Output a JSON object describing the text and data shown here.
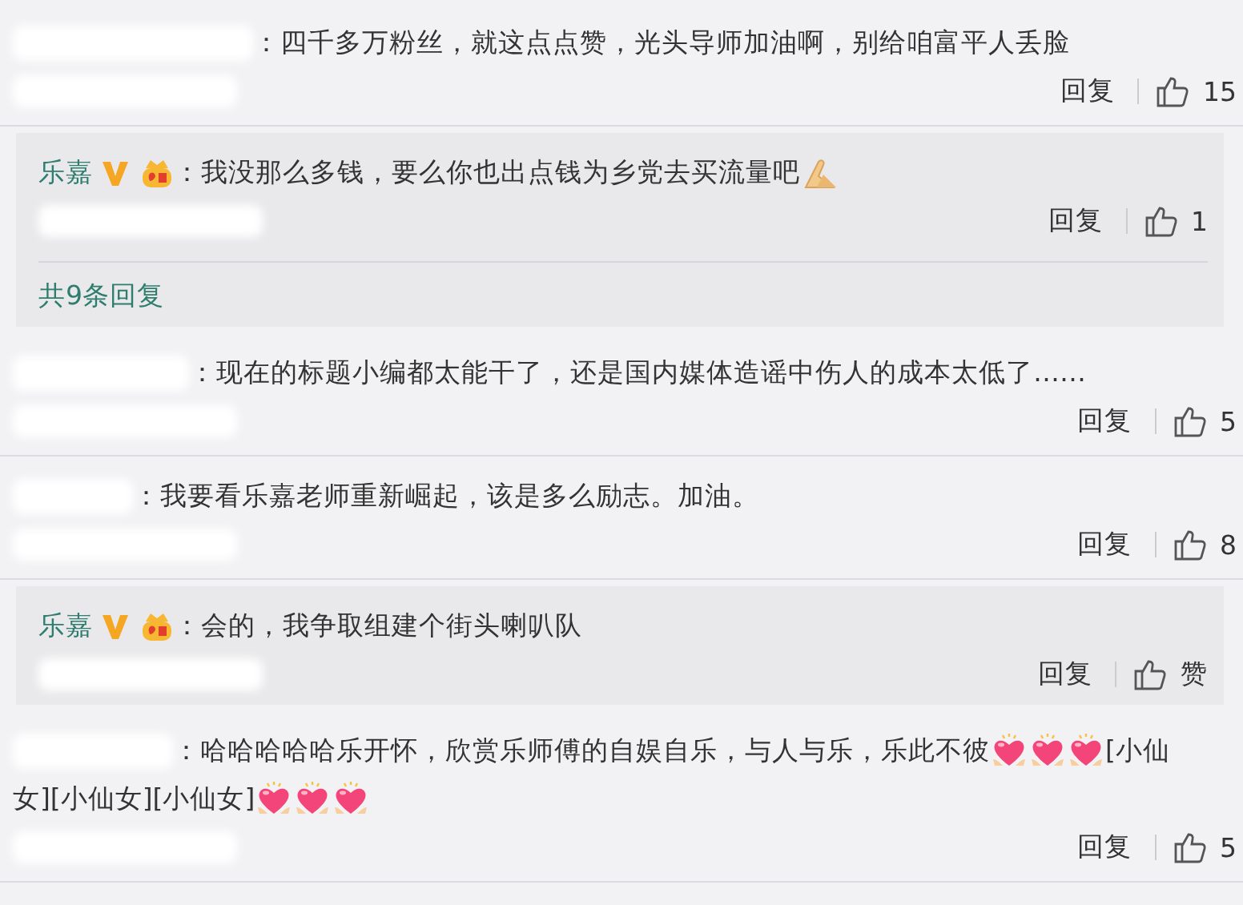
{
  "comments": [
    {
      "kind": "comment",
      "parts": [
        {
          "kind": "text",
          "text": "：四千多万粉丝，就这点点赞，光头导师加油啊，别给咱富平人丢脸"
        }
      ],
      "reply_label": "回复",
      "likes": "15"
    },
    {
      "kind": "reply",
      "user": {
        "name": "乐嘉",
        "verified": true,
        "badge": true
      },
      "parts": [
        {
          "kind": "text",
          "text": "：我没那么多钱，要么你也出点钱为乡党去买流量吧"
        },
        {
          "kind": "palms"
        }
      ],
      "reply_label": "回复",
      "likes": "1",
      "more": "共9条回复"
    },
    {
      "kind": "comment",
      "parts": [
        {
          "kind": "text",
          "text": "：现在的标题小编都太能干了，还是国内媒体造谣中伤人的成本太低了……"
        }
      ],
      "reply_label": "回复",
      "likes": "5"
    },
    {
      "kind": "comment",
      "parts": [
        {
          "kind": "text",
          "text": "：我要看乐嘉老师重新崛起，该是多么励志。加油。"
        }
      ],
      "reply_label": "回复",
      "likes": "8"
    },
    {
      "kind": "reply",
      "user": {
        "name": "乐嘉",
        "verified": true,
        "badge": true
      },
      "parts": [
        {
          "kind": "text",
          "text": "：会的，我争取组建个街头喇叭队"
        }
      ],
      "reply_label": "回复",
      "likes": "赞"
    },
    {
      "kind": "comment",
      "parts": [
        {
          "kind": "text",
          "text": "：哈哈哈哈哈乐开怀，欣赏乐师傅的自娱自乐，与人与乐，乐此不彼"
        },
        {
          "kind": "heart"
        },
        {
          "kind": "heart"
        },
        {
          "kind": "heart"
        },
        {
          "kind": "text",
          "text": "[小仙"
        },
        {
          "kind": "text",
          "text": "女][小仙女][小仙女]"
        },
        {
          "kind": "heart"
        },
        {
          "kind": "heart"
        },
        {
          "kind": "heart"
        }
      ],
      "reply_label": "回复",
      "likes": "5"
    }
  ]
}
